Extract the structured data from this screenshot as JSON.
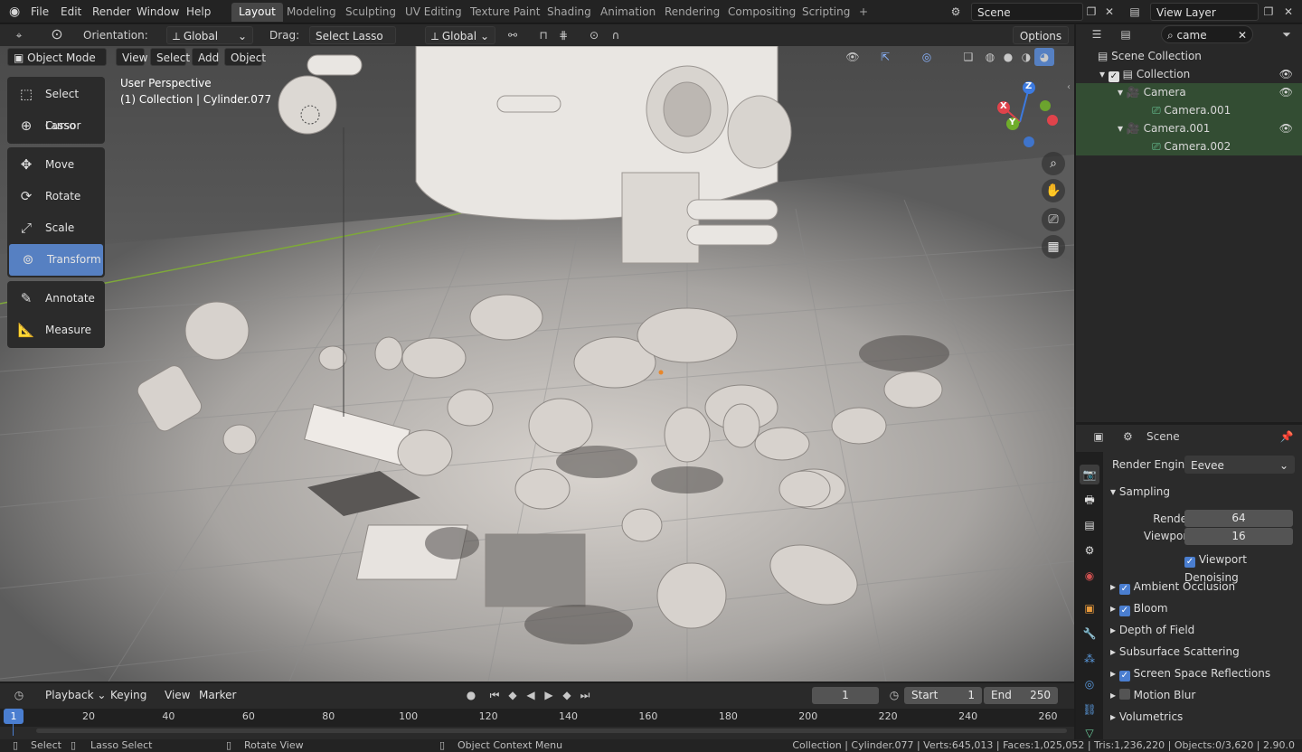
{
  "menu": [
    "File",
    "Edit",
    "Render",
    "Window",
    "Help"
  ],
  "workspaces": [
    "Layout",
    "Modeling",
    "Sculpting",
    "UV Editing",
    "Texture Paint",
    "Shading",
    "Animation",
    "Rendering",
    "Compositing",
    "Scripting"
  ],
  "add_workspace": "+",
  "scene_name": "Scene",
  "view_layer": "View Layer",
  "tool_header": {
    "orientation_label": "Orientation:",
    "orientation_value": "Global",
    "drag_label": "Drag:",
    "drag_value": "Select Lasso",
    "pivot_value": "Global",
    "options_label": "Options"
  },
  "view_header": {
    "mode": "Object Mode",
    "view": "View",
    "select": "Select",
    "add": "Add",
    "object": "Object"
  },
  "viewport_info": {
    "line1": "User Perspective",
    "line2": "(1) Collection | Cylinder.077"
  },
  "tools": [
    {
      "label": "Select Lasso",
      "icon": "lasso-icon"
    },
    {
      "label": "Cursor",
      "icon": "cursor-icon"
    },
    {
      "label": "Move",
      "icon": "move-icon"
    },
    {
      "label": "Rotate",
      "icon": "rotate-icon"
    },
    {
      "label": "Scale",
      "icon": "scale-icon"
    },
    {
      "label": "Transform",
      "icon": "transform-icon",
      "active": true
    },
    {
      "label": "Annotate",
      "icon": "annotate-icon"
    },
    {
      "label": "Measure",
      "icon": "measure-icon"
    }
  ],
  "gizmo_axes": {
    "x": "X",
    "y": "Y",
    "z": "Z"
  },
  "outliner": {
    "search": "came",
    "rows": [
      {
        "label": "Scene Collection",
        "icon": "collection-icon"
      },
      {
        "label": "Collection",
        "icon": "collection-icon"
      },
      {
        "label": "Camera",
        "icon": "camera-object-icon",
        "selected": true
      },
      {
        "label": "Camera.001",
        "icon": "camera-data-icon",
        "selected": true
      },
      {
        "label": "Camera.001",
        "icon": "camera-object-icon",
        "selected": true
      },
      {
        "label": "Camera.002",
        "icon": "camera-data-icon",
        "selected": true
      }
    ]
  },
  "properties": {
    "context": "Scene",
    "render_engine_label": "Render Engine",
    "render_engine": "Eevee",
    "sampling": "Sampling",
    "render_label": "Render",
    "render_samples": "64",
    "viewport_label": "Viewport",
    "viewport_samples": "16",
    "viewport_denoising": "Viewport Denoising",
    "panels": [
      {
        "label": "Ambient Occlusion",
        "checkbox": true
      },
      {
        "label": "Bloom",
        "checkbox": true
      },
      {
        "label": "Depth of Field"
      },
      {
        "label": "Subsurface Scattering"
      },
      {
        "label": "Screen Space Reflections",
        "checkbox": true
      },
      {
        "label": "Motion Blur",
        "checkbox": false
      },
      {
        "label": "Volumetrics"
      }
    ]
  },
  "timeline": {
    "playback": "Playback",
    "keying": "Keying",
    "view": "View",
    "marker": "Marker",
    "current_frame": "1",
    "start_label": "Start",
    "start": "1",
    "end_label": "End",
    "end": "250",
    "ticks": [
      "1",
      "20",
      "40",
      "60",
      "80",
      "100",
      "120",
      "140",
      "160",
      "180",
      "200",
      "220",
      "240",
      "260"
    ]
  },
  "status": {
    "select": "Select",
    "lasso_select": "Lasso Select",
    "rotate_view": "Rotate View",
    "context_menu": "Object Context Menu",
    "stats": "Collection | Cylinder.077 | Verts:645,013 | Faces:1,025,052 | Tris:1,236,220 | Objects:0/3,620 | 2.90.0"
  },
  "colors": {
    "active_tab": "#474747",
    "active_tool": "#5680c2",
    "selection_green": "#334d33",
    "checkbox_blue": "#4a7ed0",
    "x_axis": "#e0434b",
    "y_axis": "#6fad2a",
    "z_axis": "#3c7ae0"
  }
}
